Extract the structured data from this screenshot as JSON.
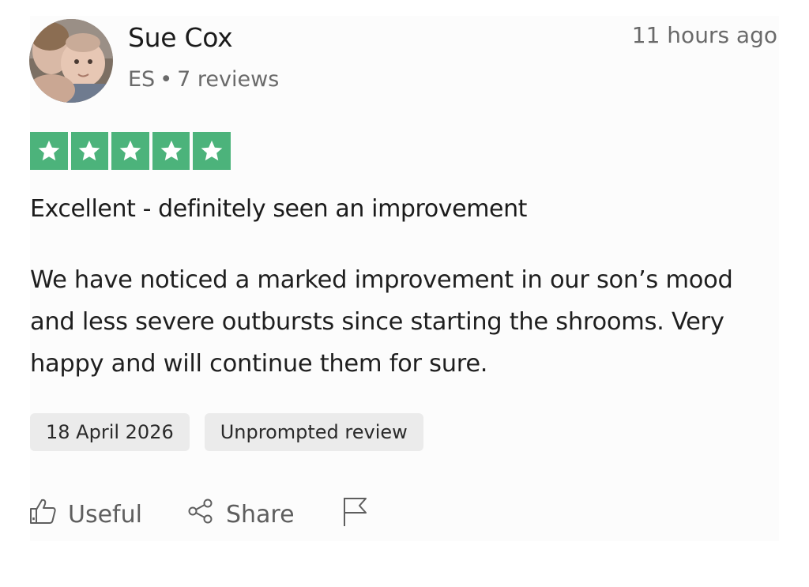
{
  "reviewer": {
    "name": "Sue Cox",
    "country": "ES",
    "separator": "•",
    "reviews": "7 reviews"
  },
  "review": {
    "time_ago": "11 hours ago",
    "rating": 5,
    "rating_max": 5,
    "rating_color": "#4cb37b",
    "title": "Excellent - definitely seen an improvement",
    "body": "We have noticed a marked improvement in our son’s mood and less severe outbursts since starting the shrooms. Very happy and will continue them for sure.",
    "date": "18 April 2026",
    "badge": "Unprompted review"
  },
  "actions": {
    "useful_label": "Useful",
    "share_label": "Share"
  },
  "icons": {
    "avatar": "avatar",
    "star": "star-icon",
    "useful": "thumbs-up-icon",
    "share": "share-icon",
    "report": "flag-icon"
  }
}
